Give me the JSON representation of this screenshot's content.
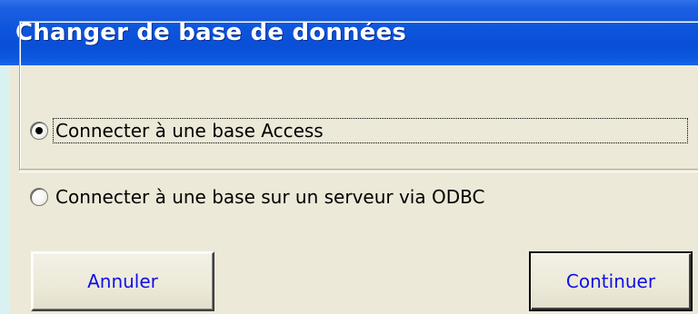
{
  "dialog": {
    "title": "Changer de base de données"
  },
  "options": [
    {
      "label": "Connecter à une base Access",
      "selected": true
    },
    {
      "label": "Connecter à une base sur un serveur via ODBC",
      "selected": false
    }
  ],
  "buttons": {
    "cancel_label": "Annuler",
    "continue_label": "Continuer"
  },
  "colors": {
    "titlebar": "#0a4fd6",
    "dialog_face": "#ece9d8",
    "button_text": "#1010e6"
  }
}
